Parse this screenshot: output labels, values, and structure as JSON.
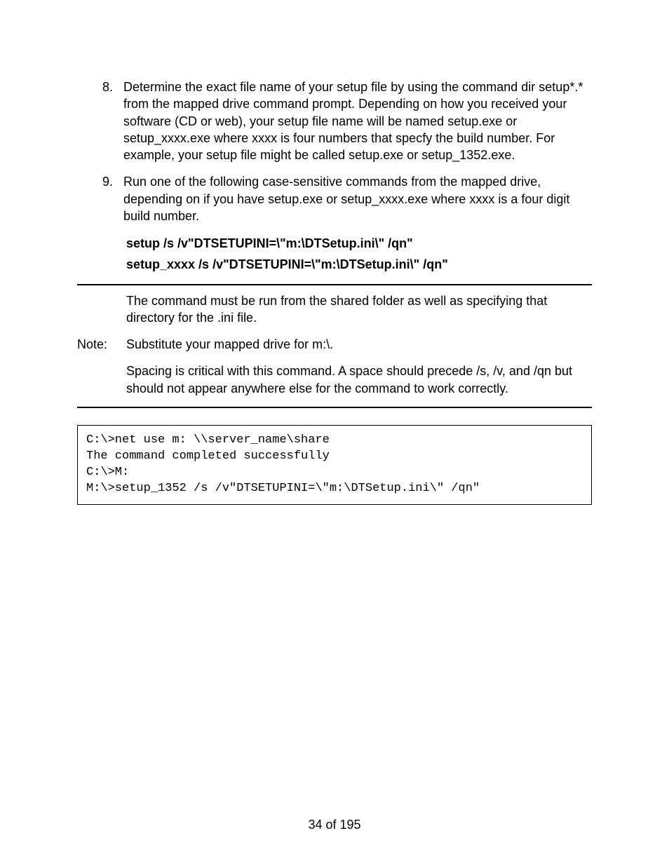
{
  "list": {
    "start": 8,
    "items": [
      "Determine the exact file name of your setup file by using the command dir setup*.* from the mapped drive command prompt. Depending on how you received your software (CD or web), your setup file name will be named setup.exe or setup_xxxx.exe where xxxx is four numbers that specfy the build number. For example, your setup file might be called setup.exe or setup_1352.exe.",
      "Run one of the following case-sensitive commands from the mapped drive, depending on if you have setup.exe or setup_xxxx.exe where xxxx is a four digit build number."
    ]
  },
  "commands": {
    "line1": "setup /s /v\"DTSETUPINI=\\\"m:\\DTSetup.ini\\\" /qn\"",
    "line2": "setup_xxxx /s /v\"DTSETUPINI=\\\"m:\\DTSetup.ini\\\" /qn\""
  },
  "note": {
    "label": "Note:",
    "p1": "The command must be run from the shared folder as well as specifying that directory for the .ini file.",
    "p2": "Substitute your mapped drive for m:\\.",
    "p3": "Spacing is critical with this command. A space should precede /s, /v, and /qn but should not appear anywhere else for the command to work correctly."
  },
  "terminal": "C:\\>net use m: \\\\server_name\\share\nThe command completed successfully\nC:\\>M:\nM:\\>setup_1352 /s /v\"DTSETUPINI=\\\"m:\\DTSetup.ini\\\" /qn\"",
  "footer": {
    "page": "34 of 195"
  }
}
